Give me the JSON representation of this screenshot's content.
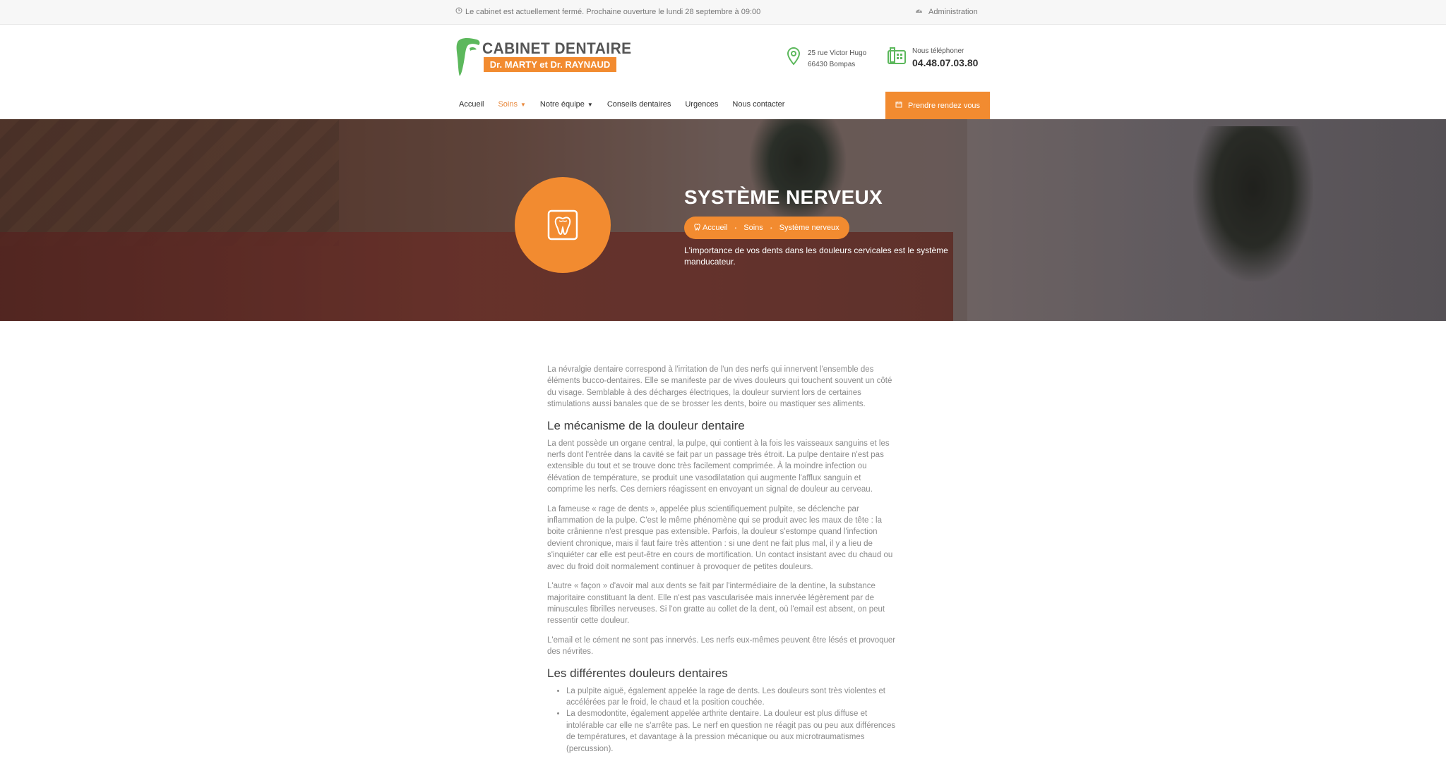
{
  "topbar": {
    "status_text": "Le cabinet est actuellement fermé. Prochaine ouverture le lundi 28 septembre à 09:00",
    "admin_label": "Administration"
  },
  "logo": {
    "title": "CABINET DENTAIRE",
    "subtitle": "Dr. MARTY et Dr. RAYNAUD"
  },
  "address": {
    "line1": "25 rue Victor Hugo",
    "line2": "66430 Bompas"
  },
  "phone": {
    "label": "Nous téléphoner",
    "number": "04.48.07.03.80"
  },
  "nav": {
    "items": [
      {
        "label": "Accueil"
      },
      {
        "label": "Soins"
      },
      {
        "label": "Notre équipe"
      },
      {
        "label": "Conseils dentaires"
      },
      {
        "label": "Urgences"
      },
      {
        "label": "Nous contacter"
      }
    ],
    "cta_label": "Prendre rendez vous"
  },
  "hero": {
    "title": "SYSTÈME NERVEUX",
    "breadcrumb": [
      "Accueil",
      "Soins",
      "Système nerveux"
    ],
    "description": "L'importance de vos dents dans les douleurs cervicales est le système manducateur."
  },
  "content": {
    "intro": "La névralgie dentaire correspond à l'irritation de l'un des nerfs qui innervent l'ensemble des éléments bucco-dentaires. Elle se manifeste par de vives douleurs qui touchent souvent un côté du visage. Semblable à des décharges électriques, la douleur survient lors de certaines stimulations aussi banales que de se brosser les dents, boire ou mastiquer ses aliments.",
    "heading1": "Le mécanisme de la douleur dentaire",
    "p1": "La dent possède un organe central, la pulpe, qui contient à la fois les vaisseaux sanguins et les nerfs dont l'entrée dans la cavité se fait par un passage très étroit. La pulpe dentaire n'est pas extensible du tout et se trouve donc très facilement comprimée. À la moindre infection ou élévation de température, se produit une vasodilatation qui augmente l'afflux sanguin et comprime les nerfs. Ces derniers réagissent en envoyant un signal de douleur au cerveau.",
    "p2": "La fameuse « rage de dents », appelée plus scientifiquement pulpite, se déclenche par inflammation de la pulpe. C'est le même phénomène qui se produit avec les maux de tête : la boite crânienne n'est presque pas extensible. Parfois, la douleur s'estompe quand l'infection devient chronique, mais il faut faire très attention : si une dent ne fait plus mal, il y a lieu de s'inquiéter car elle est peut-être en cours de mortification. Un contact insistant avec du chaud ou avec du froid doit normalement continuer à provoquer de petites douleurs.",
    "p3": "L'autre « façon » d'avoir mal aux dents se fait par l'intermédiaire de la dentine, la substance majoritaire constituant la dent. Elle n'est pas vascularisée mais innervée légèrement par de minuscules fibrilles nerveuses. Si l'on gratte au collet de la dent, où l'email est absent, on peut ressentir cette douleur.",
    "p4": "L'email et le cément ne sont pas innervés. Les nerfs eux-mêmes peuvent être lésés et provoquer des névrites.",
    "heading2": "Les différentes douleurs dentaires",
    "list": [
      "La pulpite aiguë, également appelée la rage de dents. Les douleurs sont très violentes et accélérées par le froid, le chaud et la position couchée.",
      "La desmodontite, également appelée arthrite dentaire. La douleur est plus diffuse et intolérable car elle ne s'arrête pas. Le nerf en question ne réagit pas ou peu aux différences de températures, et davantage à la pression mécanique ou aux microtraumatismes (percussion)."
    ]
  },
  "colors": {
    "accent": "#f28b30",
    "logo_green": "#5cb85c"
  }
}
